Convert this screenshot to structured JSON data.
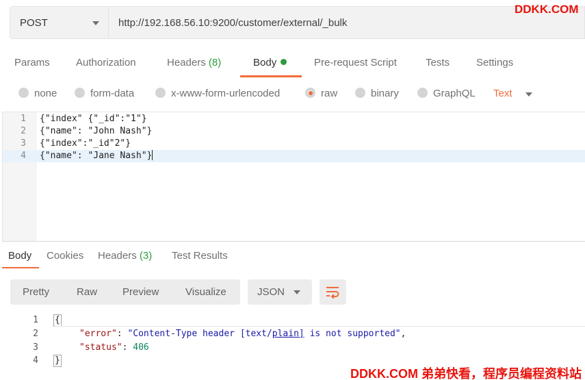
{
  "request": {
    "method": "POST",
    "url": "http://192.168.56.10:9200/customer/external/_bulk"
  },
  "watermark_top": "DDKK.COM",
  "request_tabs": [
    {
      "label": "Params"
    },
    {
      "label": "Authorization"
    },
    {
      "label": "Headers",
      "count": "(8)"
    },
    {
      "label": "Body",
      "active": true
    },
    {
      "label": "Pre-request Script"
    },
    {
      "label": "Tests"
    },
    {
      "label": "Settings"
    }
  ],
  "body_types": {
    "options": [
      "none",
      "form-data",
      "x-www-form-urlencoded",
      "raw",
      "binary",
      "GraphQL"
    ],
    "selected": "raw",
    "raw_type": "Text"
  },
  "request_body_lines": [
    {
      "n": "1",
      "text": "{\"index\" {\"_id\":\"1\"}"
    },
    {
      "n": "2",
      "text": "{\"name\": \"John Nash\"}"
    },
    {
      "n": "3",
      "text": "{\"index\":\"_id\"2\"}"
    },
    {
      "n": "4",
      "text": "{\"name\": \"Jane Nash\"}"
    }
  ],
  "response_tabs": [
    {
      "label": "Body",
      "active": true
    },
    {
      "label": "Cookies"
    },
    {
      "label": "Headers",
      "count": "(3)"
    },
    {
      "label": "Test Results"
    }
  ],
  "response_toolbar": {
    "views": [
      "Pretty",
      "Raw",
      "Preview",
      "Visualize"
    ],
    "format": "JSON",
    "wrap_icon": "wrap-lines-icon"
  },
  "response_lines": {
    "n1": "1",
    "open": "{",
    "n2": "2",
    "key_error": "\"error\"",
    "colon1": ": ",
    "val_error_a": "\"Content-Type header [text/",
    "val_error_link": "plain]",
    "val_error_b": " is not supported\"",
    "comma1": ",",
    "n3": "3",
    "key_status": "\"status\"",
    "colon2": ": ",
    "val_status": "406",
    "n4": "4",
    "close": "}"
  },
  "watermark_bottom": "DDKK.COM 弟弟快看，程序员编程资料站",
  "colors": {
    "accent": "#f26b3a",
    "count_green": "#2e9c3e",
    "watermark": "#e8140d"
  }
}
